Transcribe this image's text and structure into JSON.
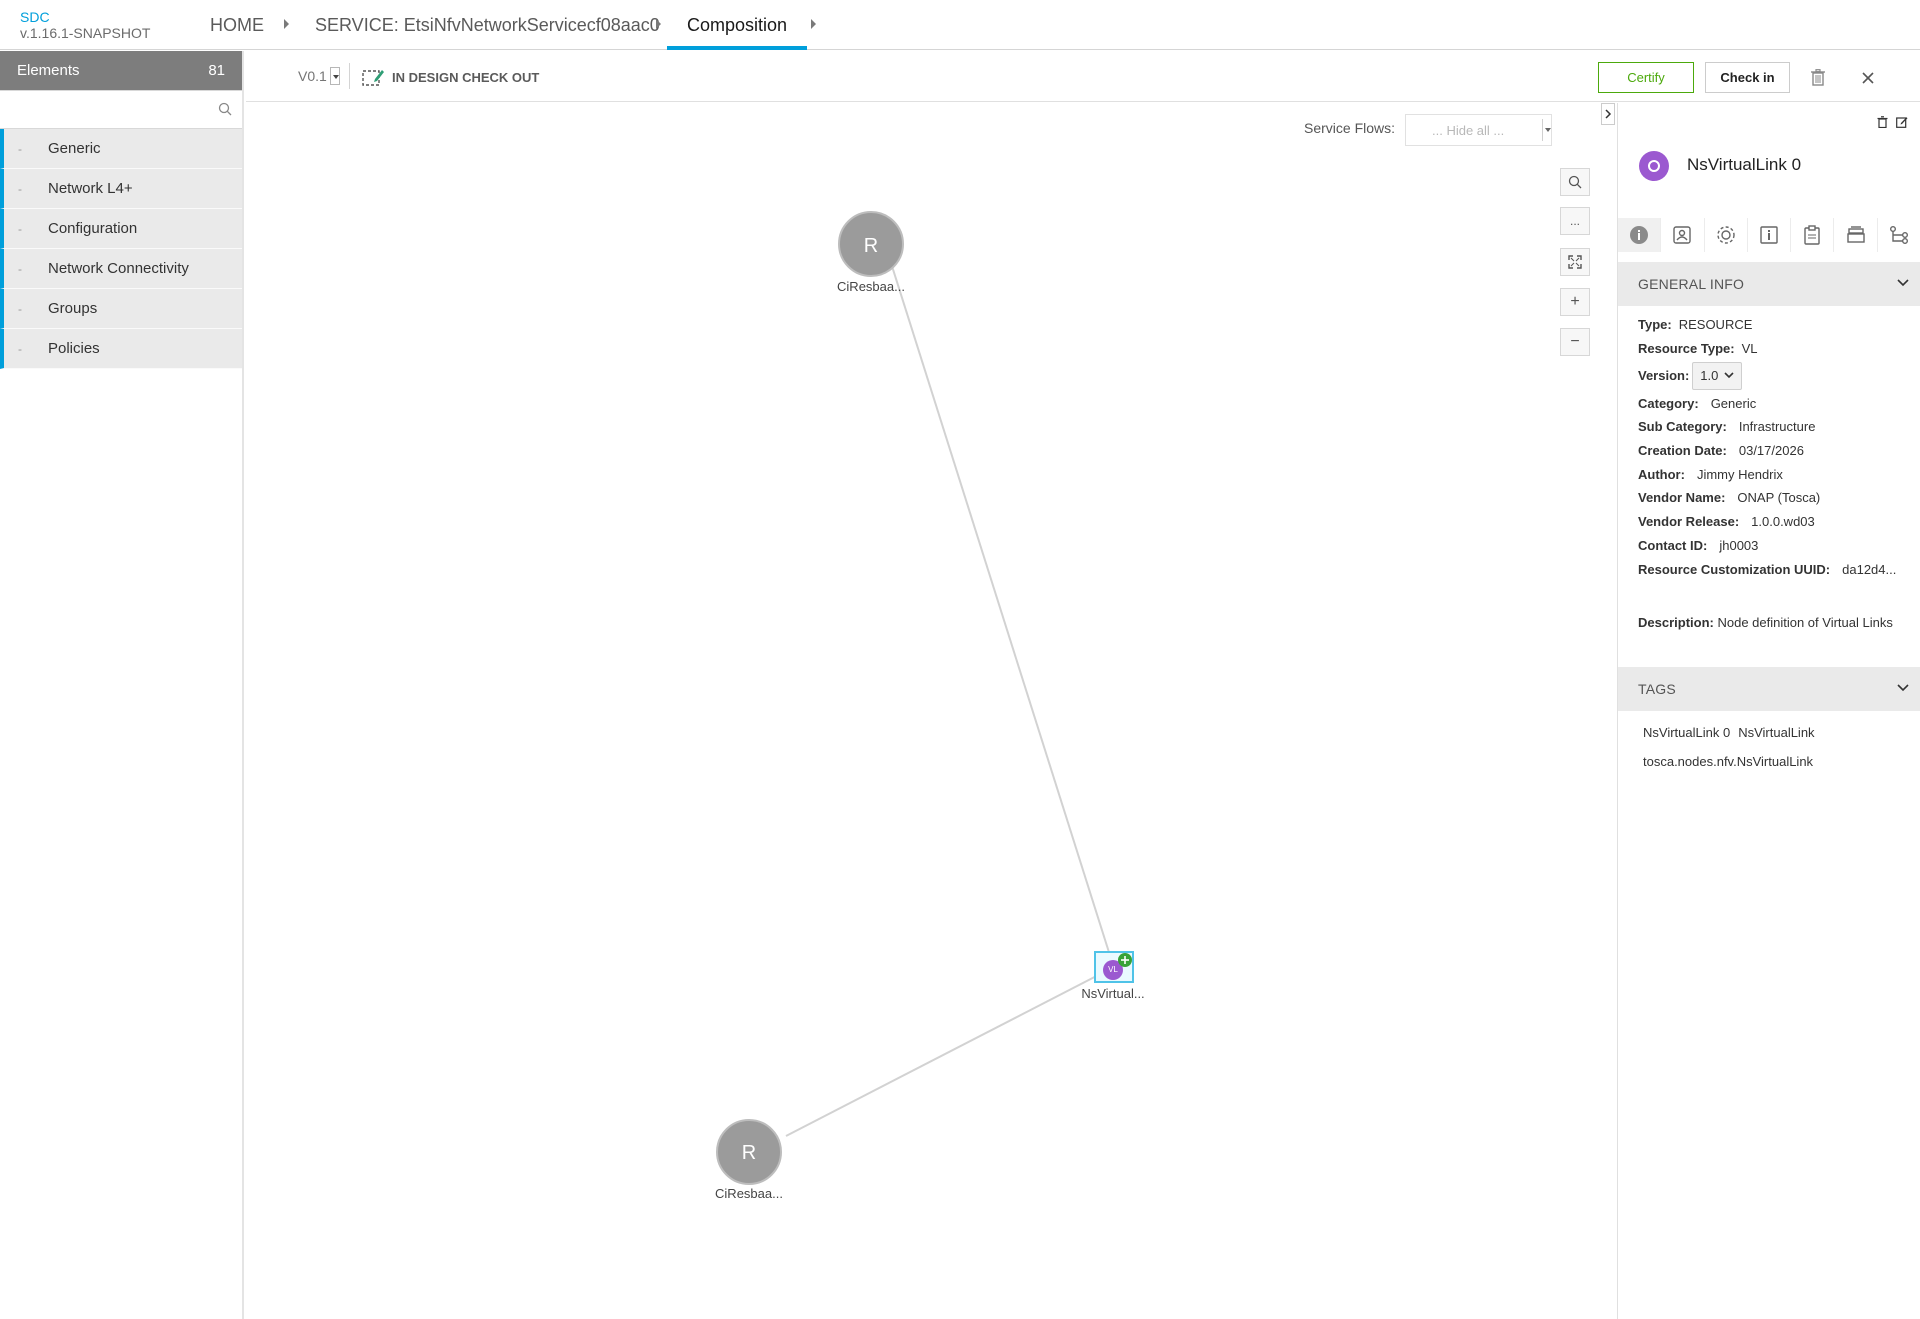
{
  "app": {
    "name": "SDC",
    "version": "v.1.16.1-SNAPSHOT"
  },
  "breadcrumb": {
    "home": "HOME",
    "service": "SERVICE: EtsiNfvNetworkServicecf08aac0",
    "active": "Composition"
  },
  "palette": {
    "title": "Elements",
    "count": "81",
    "search_placeholder": "",
    "categories": [
      {
        "label": "Generic"
      },
      {
        "label": "Network L4+"
      },
      {
        "label": "Configuration"
      },
      {
        "label": "Network Connectivity"
      },
      {
        "label": "Groups"
      },
      {
        "label": "Policies"
      }
    ]
  },
  "toolbar": {
    "version": "V0.1",
    "lifecycle": "IN DESIGN CHECK OUT",
    "certify": "Certify",
    "checkin": "Check in"
  },
  "canvas": {
    "service_flows_label": "Service Flows:",
    "service_flows_value": "... Hide all ...",
    "zoom_in": "+",
    "zoom_out": "−",
    "more": "...",
    "nodes": [
      {
        "id": "cr1",
        "letter": "R",
        "label": "CiResbaa..."
      },
      {
        "id": "cr2",
        "letter": "R",
        "label": "CiResbaa..."
      },
      {
        "id": "vl",
        "letter": "VL",
        "label": "NsVirtual..."
      }
    ]
  },
  "details": {
    "component_name": "NsVirtualLink 0",
    "general_info_title": "GENERAL INFO",
    "type_label": "Type:",
    "type_value": "RESOURCE",
    "resource_type_label": "Resource Type:",
    "resource_type_value": "VL",
    "version_label": "Version:",
    "version_value": "1.0",
    "category_label": "Category:",
    "category_value": "Generic",
    "subcategory_label": "Sub Category:",
    "subcategory_value": "Infrastructure",
    "creation_label": "Creation Date:",
    "creation_value": "03/17/2026",
    "author_label": "Author:",
    "author_value": "Jimmy Hendrix",
    "vendor_name_label": "Vendor Name:",
    "vendor_name_value": "ONAP (Tosca)",
    "vendor_release_label": "Vendor Release:",
    "vendor_release_value": "1.0.0.wd03",
    "contact_label": "Contact ID:",
    "contact_value": "jh0003",
    "uuid_label": "Resource Customization UUID:",
    "uuid_value": "da12d4...",
    "description_label": "Description:",
    "description_value": "Node definition of Virtual Links",
    "tags_title": "TAGS",
    "tags": [
      "NsVirtualLink 0",
      "NsVirtualLink",
      "tosca.nodes.nfv.NsVirtualLink"
    ]
  },
  "colors": {
    "accent": "#009fdb",
    "certify": "#4ca90c",
    "vl_node": "#9b59d0",
    "node_gray": "#9b9b9b"
  }
}
